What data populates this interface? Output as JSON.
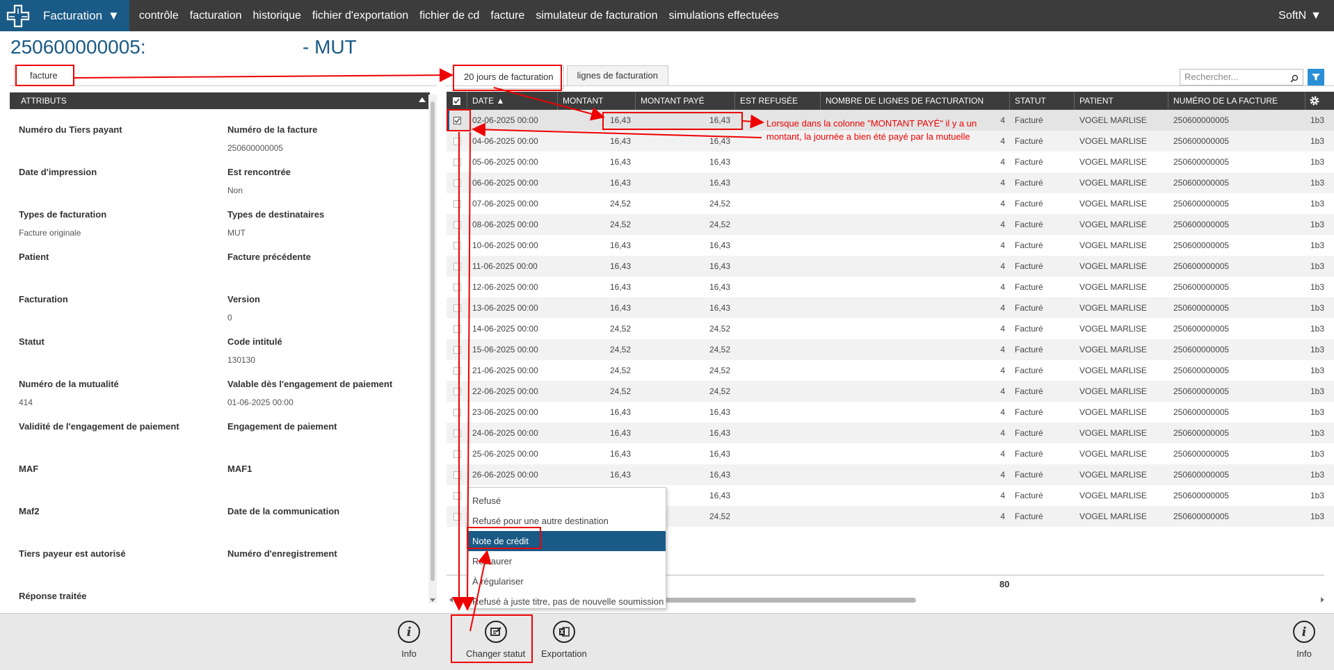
{
  "topbar": {
    "app_menu_label": "Facturation",
    "nav": [
      "contrôle",
      "facturation",
      "historique",
      "fichier d'exportation",
      "fichier de cd",
      "facture",
      "simulateur de facturation",
      "simulations effectuées"
    ],
    "user": "SoftN"
  },
  "title": {
    "id": "250600000005:",
    "suffix": "- MUT"
  },
  "left_panel": {
    "tab_label": "facture",
    "header": "ATTRIBUTS",
    "attributes": [
      {
        "label": "Numéro du Tiers payant",
        "value": ""
      },
      {
        "label": "Numéro de la facture",
        "value": "250600000005"
      },
      {
        "label": "Date d'impression",
        "value": ""
      },
      {
        "label": "Est rencontrée",
        "value": "Non"
      },
      {
        "label": "Types de facturation",
        "value": "Facture originale"
      },
      {
        "label": "Types de destinataires",
        "value": "MUT"
      },
      {
        "label": "Patient",
        "value": ""
      },
      {
        "label": "Facture précédente",
        "value": ""
      },
      {
        "label": "Facturation",
        "value": ""
      },
      {
        "label": "Version",
        "value": "0"
      },
      {
        "label": "Statut",
        "value": ""
      },
      {
        "label": "Code intitulé",
        "value": "130130"
      },
      {
        "label": "Numéro de la mutualité",
        "value": "414"
      },
      {
        "label": "Valable dès l'engagement de paiement",
        "value": "01-06-2025 00:00"
      },
      {
        "label": "Validité de l'engagement de paiement",
        "value": ""
      },
      {
        "label": "Engagement de paiement",
        "value": ""
      },
      {
        "label": "MAF",
        "value": ""
      },
      {
        "label": "MAF1",
        "value": ""
      },
      {
        "label": "Maf2",
        "value": ""
      },
      {
        "label": "Date de la communication",
        "value": ""
      },
      {
        "label": "Tiers payeur est autorisé",
        "value": ""
      },
      {
        "label": "Numéro d'enregistrement",
        "value": ""
      },
      {
        "label": "Réponse traitée",
        "value": ""
      }
    ]
  },
  "right_panel": {
    "tabs": [
      "20 jours de facturation",
      "lignes de facturation"
    ],
    "search_placeholder": "Rechercher...",
    "columns": [
      "DATE",
      "MONTANT",
      "MONTANT PAYÉ",
      "EST REFUSÉE",
      "NOMBRE DE LIGNES DE FACTURATION",
      "STATUT",
      "PATIENT",
      "NUMÉRO DE LA FACTURE"
    ],
    "rows": [
      {
        "date": "02-06-2025 00:00",
        "montant": "16,43",
        "paye": "16,43",
        "refusee": "",
        "nb": "4",
        "statut": "Facturé",
        "patient": "VOGEL MARLISE",
        "numero": "250600000005",
        "extra": "1b3",
        "checked": true
      },
      {
        "date": "04-06-2025 00:00",
        "montant": "16,43",
        "paye": "16,43",
        "refusee": "",
        "nb": "4",
        "statut": "Facturé",
        "patient": "VOGEL MARLISE",
        "numero": "250600000005",
        "extra": "1b3",
        "checked": false
      },
      {
        "date": "05-06-2025 00:00",
        "montant": "16,43",
        "paye": "16,43",
        "refusee": "",
        "nb": "4",
        "statut": "Facturé",
        "patient": "VOGEL MARLISE",
        "numero": "250600000005",
        "extra": "1b3",
        "checked": false
      },
      {
        "date": "06-06-2025 00:00",
        "montant": "16,43",
        "paye": "16,43",
        "refusee": "",
        "nb": "4",
        "statut": "Facturé",
        "patient": "VOGEL MARLISE",
        "numero": "250600000005",
        "extra": "1b3",
        "checked": false
      },
      {
        "date": "07-06-2025 00:00",
        "montant": "24,52",
        "paye": "24,52",
        "refusee": "",
        "nb": "4",
        "statut": "Facturé",
        "patient": "VOGEL MARLISE",
        "numero": "250600000005",
        "extra": "1b3",
        "checked": false
      },
      {
        "date": "08-06-2025 00:00",
        "montant": "24,52",
        "paye": "24,52",
        "refusee": "",
        "nb": "4",
        "statut": "Facturé",
        "patient": "VOGEL MARLISE",
        "numero": "250600000005",
        "extra": "1b3",
        "checked": false
      },
      {
        "date": "10-06-2025 00:00",
        "montant": "16,43",
        "paye": "16,43",
        "refusee": "",
        "nb": "4",
        "statut": "Facturé",
        "patient": "VOGEL MARLISE",
        "numero": "250600000005",
        "extra": "1b3",
        "checked": false
      },
      {
        "date": "11-06-2025 00:00",
        "montant": "16,43",
        "paye": "16,43",
        "refusee": "",
        "nb": "4",
        "statut": "Facturé",
        "patient": "VOGEL MARLISE",
        "numero": "250600000005",
        "extra": "1b3",
        "checked": false
      },
      {
        "date": "12-06-2025 00:00",
        "montant": "16,43",
        "paye": "16,43",
        "refusee": "",
        "nb": "4",
        "statut": "Facturé",
        "patient": "VOGEL MARLISE",
        "numero": "250600000005",
        "extra": "1b3",
        "checked": false
      },
      {
        "date": "13-06-2025 00:00",
        "montant": "16,43",
        "paye": "16,43",
        "refusee": "",
        "nb": "4",
        "statut": "Facturé",
        "patient": "VOGEL MARLISE",
        "numero": "250600000005",
        "extra": "1b3",
        "checked": false
      },
      {
        "date": "14-06-2025 00:00",
        "montant": "24,52",
        "paye": "24,52",
        "refusee": "",
        "nb": "4",
        "statut": "Facturé",
        "patient": "VOGEL MARLISE",
        "numero": "250600000005",
        "extra": "1b3",
        "checked": false
      },
      {
        "date": "15-06-2025 00:00",
        "montant": "24,52",
        "paye": "24,52",
        "refusee": "",
        "nb": "4",
        "statut": "Facturé",
        "patient": "VOGEL MARLISE",
        "numero": "250600000005",
        "extra": "1b3",
        "checked": false
      },
      {
        "date": "21-06-2025 00:00",
        "montant": "24,52",
        "paye": "24,52",
        "refusee": "",
        "nb": "4",
        "statut": "Facturé",
        "patient": "VOGEL MARLISE",
        "numero": "250600000005",
        "extra": "1b3",
        "checked": false
      },
      {
        "date": "22-06-2025 00:00",
        "montant": "24,52",
        "paye": "24,52",
        "refusee": "",
        "nb": "4",
        "statut": "Facturé",
        "patient": "VOGEL MARLISE",
        "numero": "250600000005",
        "extra": "1b3",
        "checked": false
      },
      {
        "date": "23-06-2025 00:00",
        "montant": "16,43",
        "paye": "16,43",
        "refusee": "",
        "nb": "4",
        "statut": "Facturé",
        "patient": "VOGEL MARLISE",
        "numero": "250600000005",
        "extra": "1b3",
        "checked": false
      },
      {
        "date": "24-06-2025 00:00",
        "montant": "16,43",
        "paye": "16,43",
        "refusee": "",
        "nb": "4",
        "statut": "Facturé",
        "patient": "VOGEL MARLISE",
        "numero": "250600000005",
        "extra": "1b3",
        "checked": false
      },
      {
        "date": "25-06-2025 00:00",
        "montant": "16,43",
        "paye": "16,43",
        "refusee": "",
        "nb": "4",
        "statut": "Facturé",
        "patient": "VOGEL MARLISE",
        "numero": "250600000005",
        "extra": "1b3",
        "checked": false
      },
      {
        "date": "26-06-2025 00:00",
        "montant": "16,43",
        "paye": "16,43",
        "refusee": "",
        "nb": "4",
        "statut": "Facturé",
        "patient": "VOGEL MARLISE",
        "numero": "250600000005",
        "extra": "1b3",
        "checked": false
      },
      {
        "date": "",
        "montant": "",
        "paye": "16,43",
        "refusee": "",
        "nb": "4",
        "statut": "Facturé",
        "patient": "VOGEL MARLISE",
        "numero": "250600000005",
        "extra": "1b3",
        "checked": false
      },
      {
        "date": "",
        "montant": "",
        "paye": "24,52",
        "refusee": "",
        "nb": "4",
        "statut": "Facturé",
        "patient": "VOGEL MARLISE",
        "numero": "250600000005",
        "extra": "1b3",
        "checked": false
      }
    ],
    "total": "80"
  },
  "context_menu": {
    "items": [
      "Refusé",
      "Refusé pour une autre destination",
      "Note de crédit",
      "Restaurer",
      "À régulariser",
      "Refusé à juste titre, pas de nouvelle soumission"
    ],
    "active_index": 2
  },
  "toolbar": {
    "info_label": "Info",
    "change_status_label": "Changer statut",
    "export_label": "Exportation",
    "info_right_label": "Info"
  },
  "annotation": {
    "text": "Lorsque dans la colonne \"MONTANT PAYÉ\" il y a un montant, la journée a bien été payé par la mutuelle",
    "color": "#e00000"
  },
  "colors": {
    "primary": "#1a5a86",
    "topbar": "#3c3c3c",
    "accent": "#2a8fd6"
  }
}
